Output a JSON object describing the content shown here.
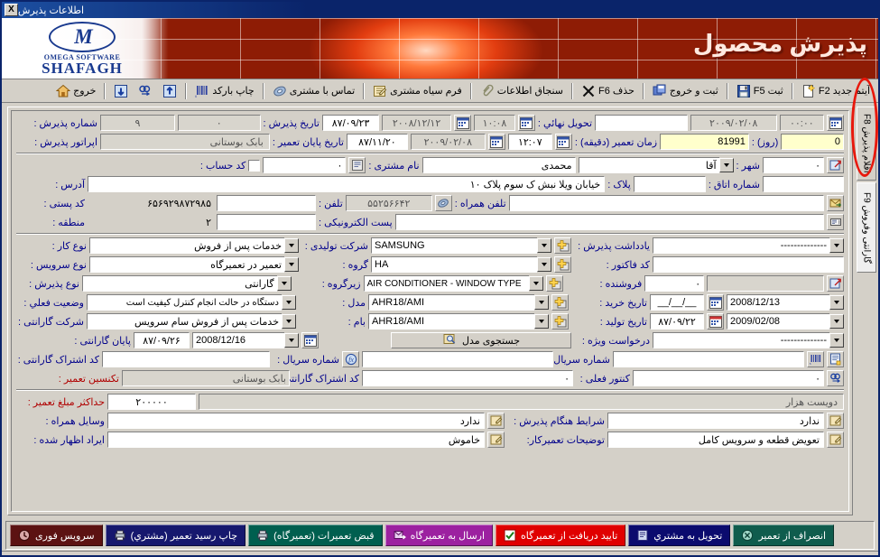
{
  "window": {
    "title": "اطلاعات پذیرش",
    "close_label": "X"
  },
  "banner": {
    "title": "پذیرش محصول",
    "logo_mark": "M",
    "logo_line1": "OMEGA SOFTWARE",
    "logo_line2": "SHAFAGH"
  },
  "toolbar": {
    "items": [
      {
        "label": "آیتم جدید F2",
        "icon": "new-document-icon"
      },
      {
        "label": "ثبت  F5",
        "icon": "save-disk-icon"
      },
      {
        "label": "ثبت و خروج",
        "icon": "save-exit-icon"
      },
      {
        "label": "حذف   F6",
        "icon": "delete-x-icon"
      },
      {
        "label": "سنجاق اطلاعات",
        "icon": "paperclip-icon"
      },
      {
        "label": "فرم سیاه مشتری",
        "icon": "edit-form-icon"
      },
      {
        "label": "تماس با مشتری",
        "icon": "phone-icon"
      },
      {
        "label": "چاپ بارکد",
        "icon": "barcode-icon"
      },
      {
        "label": "خروج",
        "icon": "home-exit-icon"
      }
    ],
    "extra_icons": [
      "import-icon",
      "find-icon",
      "export-icon"
    ]
  },
  "side_tabs": [
    {
      "label": "اقلام پذیرش F8",
      "active": true
    },
    {
      "label": "گارانتی وفروش F9",
      "active": false
    }
  ],
  "form": {
    "reception_no_label": "شماره پذیرش :",
    "reception_no_value": "۹",
    "reception_no_value2": "۰",
    "operator_label": "اپراتور پذیرش :",
    "operator_value": "بابک  بوستانی",
    "reception_date_label": "تاریخ پذیرش :",
    "reception_date_jalali": "۸۷/۰۹/۲۳",
    "reception_date_greg": "۲۰۰۸/۱۲/۱۲",
    "repair_end_date_label": "تاریخ پایان تعمیر :",
    "repair_end_jalali": "۸۷/۱۱/۲۰",
    "repair_end_greg": "۲۰۰۹/۰۲/۰۸",
    "final_delivery_label": "تحویل نهائي :",
    "final_delivery_blank": "",
    "final_delivery_greg": "۲۰۰۹/۰۲/۰۸",
    "final_delivery_time": "۰۰:۰۰",
    "reception_time": "۱۰:۰۸",
    "repair_end_time": "۱۲:۰۷",
    "repair_minutes_label": "زمان تعمیر  (دقیقه) :",
    "repair_minutes_value": "81991",
    "repair_days_label": "(روز) :",
    "repair_days_value": "0"
  },
  "customer": {
    "account_code_label": "کد حساب :",
    "account_code_value": "",
    "account_code_dot": "٠",
    "customer_name_label": "نام مشتری :",
    "customer_title": "آقا",
    "customer_name_value": "محمدی",
    "city_label": "شهر :",
    "city_value": "٠",
    "address_label": "آدرس :",
    "address_value": "خیابان ویلا نبش ک سوم پلاک ۱۰",
    "plate_label": "پلاک :",
    "plate_value": "",
    "postal_code_label": "کد پستی :",
    "postal_code_value": "۶۵۶۹۲۹۸۷۲۹۸۵",
    "phone_label": "تلفن :",
    "phone_value": "۵۵۲۵۶۶۴۲",
    "room_no_label": "شماره اتاق :",
    "room_no_value": "",
    "region_label": "منطقه :",
    "region_value": "۲",
    "mobile_label": "تلفن همراه :",
    "mobile_value": "",
    "email_label": "پست الکترونیکی :",
    "email_value": ""
  },
  "service": {
    "work_type_label": "نوع کار :",
    "work_type_value": "خدمات پس از فروش",
    "service_type_label": "نوع سرویس :",
    "service_type_value": "تعمیر در تعمیرگاه",
    "reception_type_label": "نوع پذیرش :",
    "reception_type_value": "گارانتی",
    "current_status_label": "وضعیت فعلي :",
    "current_status_value": "دستگاه در حالت انجام کنترل کیفیت است",
    "warranty_company_label": "شرکت گارانتی :",
    "warranty_company_value": "خدمات پس از فروش سام سرویس"
  },
  "product": {
    "manufacturer_label": "شرکت تولیدی :",
    "manufacturer_value": "SAMSUNG",
    "group_label": "گروه :",
    "group_value": "HA",
    "subgroup_label": "زیرگروه :",
    "subgroup_value": "AIR CONDITIONER - WINDOW TYPE",
    "model_label": "مدل :",
    "model_value": "AHR18/AMI",
    "bam_label": "بام :",
    "bam_value": "AHR18/AMI",
    "model_search_label": "جستجوی مدل",
    "serial_no_label": "شماره سریال :",
    "serial_no_value": "",
    "warranty_sub_code_label": "کد اشتراک گارانتی :",
    "warranty_sub_code_value": "٠",
    "current_counter_label": "کنتور فعلی :",
    "current_counter_value": "٠"
  },
  "sales": {
    "reception_note_label": "یادداشت پذیرش :",
    "reception_note_value": "--------------",
    "invoice_code_label": "کد فاکتور :",
    "invoice_code_value": "",
    "seller_label": "فروشنده :",
    "seller_value": "٠",
    "seller_name_value": "",
    "purchase_date_label": "تاریخ خرید :",
    "purchase_date_jalali": "__/__/__",
    "purchase_date_greg": "2008/12/13",
    "production_date_label": "تاریخ تولید :",
    "production_date_jalali": "۸۷/۰۹/۲۲",
    "production_date_greg": "2009/02/08",
    "special_request_label": "درخواست ویژه :",
    "special_request_value": "--------------"
  },
  "warranty": {
    "warranty_end_label": "پایان گارانتی :",
    "warranty_end_jalali": "۸۷/۰۹/۲۶",
    "warranty_end_greg": "2008/12/16",
    "technician_label": "تکنسین تعمیر :",
    "technician_value": "بابک  بوستانی"
  },
  "amounts": {
    "max_repair_amount_label": "حداکثر مبلغ تعمیر :",
    "max_repair_amount_value": "۲۰۰۰۰۰",
    "max_repair_amount_words": "دویست  هزار",
    "accessories_label": "وسایل همراه :",
    "accessories_value": "ندارد",
    "declared_fault_label": "ایراد اظهار شده :",
    "declared_fault_value": "خاموش",
    "reception_conditions_label": "شرایط هنگام پذیرش :",
    "reception_conditions_value": "ندارد",
    "technician_notes_label": "توضیحات تعمیرکار:",
    "technician_notes_value": "تعویض قطعه و سرویس کامل"
  },
  "bottom_buttons": [
    {
      "label": "سرویس فوری",
      "bg": "#5c1212",
      "icon": "urgent-icon"
    },
    {
      "label": "چاپ رسید تعمیر (مشتري)",
      "bg": "#16186e",
      "icon": "printer-icon"
    },
    {
      "label": "قبض تعمیرات (تعمیرگاه)",
      "bg": "#005f4f",
      "icon": "printer-icon"
    },
    {
      "label": "ارسال به تعمیرگاه",
      "bg": "#9c21a0",
      "icon": "send-icon"
    },
    {
      "label": "تایید دریافت از تعمیرگاه",
      "bg": "#e00000",
      "icon": "check-icon"
    },
    {
      "label": "تحویل به مشتري",
      "bg": "#0b0b6e",
      "icon": "delivery-icon"
    },
    {
      "label": "انصراف از تعمیر",
      "bg": "#0f5c4d",
      "icon": "cancel-icon"
    }
  ],
  "colors": {
    "accent_blue": "#00008b",
    "accent_red": "#b00000",
    "window_chrome": "#d4d0c8",
    "titlebar": "#0a246a",
    "banner_red": "#e23d10",
    "highlight_ring": "#e8180c"
  }
}
